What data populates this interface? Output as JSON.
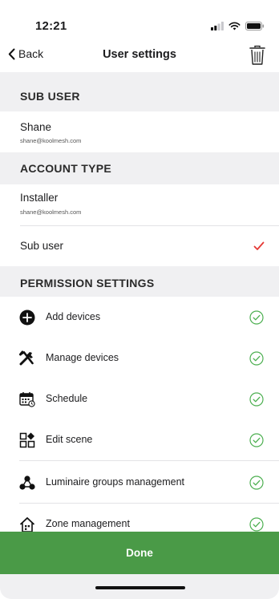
{
  "status_bar": {
    "time": "12:21"
  },
  "nav": {
    "back_label": "Back",
    "title": "User settings",
    "trash_icon": "trash-icon"
  },
  "sub_user": {
    "header": "SUB USER",
    "name": "Shane",
    "email": "shane@koolmesh.com"
  },
  "account_type": {
    "header": "ACCOUNT TYPE",
    "options": [
      {
        "label": "Installer",
        "sub": "shane@koolmesh.com",
        "selected": false
      },
      {
        "label": "Sub user",
        "sub": "",
        "selected": true
      }
    ],
    "check_color": "#e53935"
  },
  "permissions": {
    "header": "PERMISSION SETTINGS",
    "check_color": "#4caf50",
    "items": [
      {
        "label": "Add devices",
        "icon": "add-circle-icon",
        "enabled": true
      },
      {
        "label": "Manage devices",
        "icon": "tools-icon",
        "enabled": true
      },
      {
        "label": "Schedule",
        "icon": "calendar-icon",
        "enabled": true
      },
      {
        "label": "Edit scene",
        "icon": "scene-icon",
        "enabled": true
      },
      {
        "label": "Luminaire groups management",
        "icon": "group-icon",
        "enabled": true
      },
      {
        "label": "Zone management",
        "icon": "home-icon",
        "enabled": true
      }
    ]
  },
  "done_label": "Done",
  "colors": {
    "done_bg": "#4a9a47",
    "section_bg": "#f0f0f2"
  }
}
